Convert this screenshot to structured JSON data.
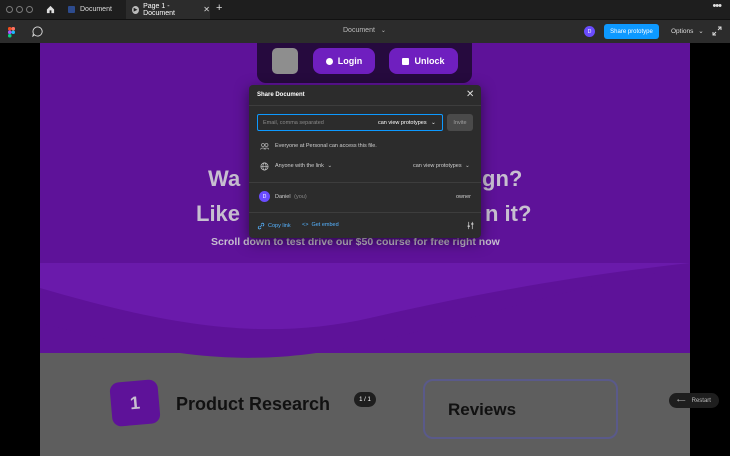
{
  "titlebar": {
    "tabs": [
      {
        "label": "Document"
      },
      {
        "label": "Page 1 - Document"
      }
    ]
  },
  "toolbar": {
    "doc_title": "Document",
    "avatar_initial": "D",
    "share_label": "Share prototype",
    "options_label": "Options"
  },
  "canvas": {
    "nav": {
      "login": "Login",
      "unlock": "Unlock"
    },
    "headline_line1_left": "Wa",
    "headline_line1_right": "gn?",
    "headline_line2_left": "Like",
    "headline_line2_right": "n it?",
    "subline": "Scroll down to test drive our $50 course for free right now",
    "step_number": "1",
    "step_title": "Product Research",
    "page_indicator": "1 / 1",
    "reviews_title": "Reviews",
    "restart_label": "Restart"
  },
  "dialog": {
    "title": "Share Document",
    "email_placeholder": "Email, comma separated",
    "permission": "can view prototypes",
    "invite_label": "Invite",
    "org_access_text": "Everyone at Personal can access this file.",
    "link_access_label": "Anyone with the link",
    "link_permission": "can view prototypes",
    "user_initial": "D",
    "user_name": "Daniel",
    "user_you": "(you)",
    "user_role": "owner",
    "copy_link": "Copy link",
    "get_embed": "Get embed"
  },
  "colors": {
    "accent": "#0d99ff",
    "brand_purple": "#5e1299",
    "avatar": "#6a4cff"
  }
}
